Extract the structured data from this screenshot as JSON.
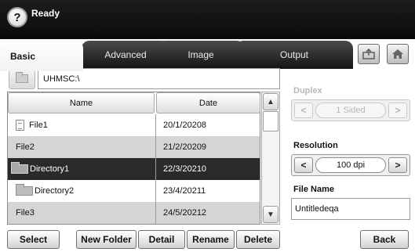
{
  "header": {
    "status": "Ready",
    "help_glyph": "?"
  },
  "tabs": [
    {
      "label": "Basic",
      "active": true
    },
    {
      "label": "Advanced",
      "active": false
    },
    {
      "label": "Image",
      "active": false
    },
    {
      "label": "Output",
      "active": false
    }
  ],
  "header_icons": {
    "export": "export-icon",
    "home": "home-icon"
  },
  "path": {
    "value": "UHMSC:\\"
  },
  "file_list": {
    "columns": [
      "Name",
      "Date"
    ],
    "rows": [
      {
        "name": "File1",
        "date": "20/1/20208",
        "type": "file"
      },
      {
        "name": "File2",
        "date": "21/2/20209",
        "type": "plain"
      },
      {
        "name": "Directory1",
        "date": "22/3/20210",
        "type": "directory",
        "selected": true
      },
      {
        "name": "Directory2",
        "date": "23/4/20211",
        "type": "directory"
      },
      {
        "name": "File3",
        "date": "24/5/20212",
        "type": "plain"
      }
    ]
  },
  "buttons": {
    "select": "Select",
    "new_folder": "New Folder",
    "detail": "Detail",
    "rename": "Rename",
    "delete": "Delete",
    "back": "Back"
  },
  "duplex": {
    "label": "Duplex",
    "value": "1 Sided",
    "enabled": false
  },
  "resolution": {
    "label": "Resolution",
    "value": "100 dpi"
  },
  "file_name": {
    "label": "File Name",
    "value": "Untitledeqa"
  },
  "colors": {
    "header_bg": "#111111",
    "selected_row": "#2a2a2a",
    "alt_row": "#d5d5d5"
  }
}
